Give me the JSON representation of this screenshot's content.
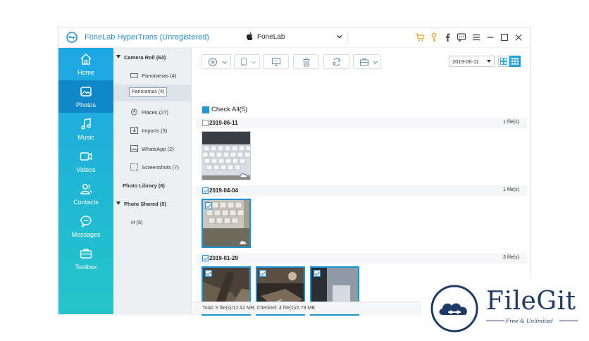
{
  "app": {
    "title": "FoneLab HyperTrans (Unregistered)"
  },
  "device": {
    "name": "FoneLab"
  },
  "nav": {
    "items": [
      {
        "label": "Home",
        "icon": "home-icon"
      },
      {
        "label": "Photos",
        "icon": "photos-icon"
      },
      {
        "label": "Music",
        "icon": "music-icon"
      },
      {
        "label": "Videos",
        "icon": "videos-icon"
      },
      {
        "label": "Contacts",
        "icon": "contacts-icon"
      },
      {
        "label": "Messages",
        "icon": "messages-icon"
      },
      {
        "label": "Toolbox",
        "icon": "toolbox-icon"
      }
    ],
    "active": "Photos"
  },
  "tree": {
    "camera_roll": "Camera Roll (63)",
    "panoramas": "Panoramas (4)",
    "drag_label": "Panoramas (4)",
    "places": "Places (27)",
    "imports": "Imports (3)",
    "whatsapp": "WhatsApp (2)",
    "screenshots": "Screenshots (7)",
    "photo_library": "Photo Library (6)",
    "photo_shared": "Photo Shared (5)",
    "h_album": "H (5)"
  },
  "toolbar": {
    "date_value": "2019-06-11"
  },
  "main": {
    "check_all": "Check All(5)",
    "groups": [
      {
        "date": "2019-06-11",
        "count": "1 file(s)",
        "checked": false
      },
      {
        "date": "2019-04-04",
        "count": "1 file(s)",
        "checked": true
      },
      {
        "date": "2019-01-29",
        "count": "3 file(s)",
        "checked": true
      }
    ]
  },
  "status": {
    "text": "Total: 5 file(s)/12.42 MB; Checked: 4 file(s)/2.79 MB"
  },
  "watermark": {
    "name": "FileGit",
    "tagline": "Free & Unlimited"
  },
  "colors": {
    "accent": "#1f95d8",
    "nav_top": "#1ea6e4",
    "nav_bottom": "#24c5c9",
    "nav_active": "#1087c7",
    "watermark": "#1f3a66"
  }
}
